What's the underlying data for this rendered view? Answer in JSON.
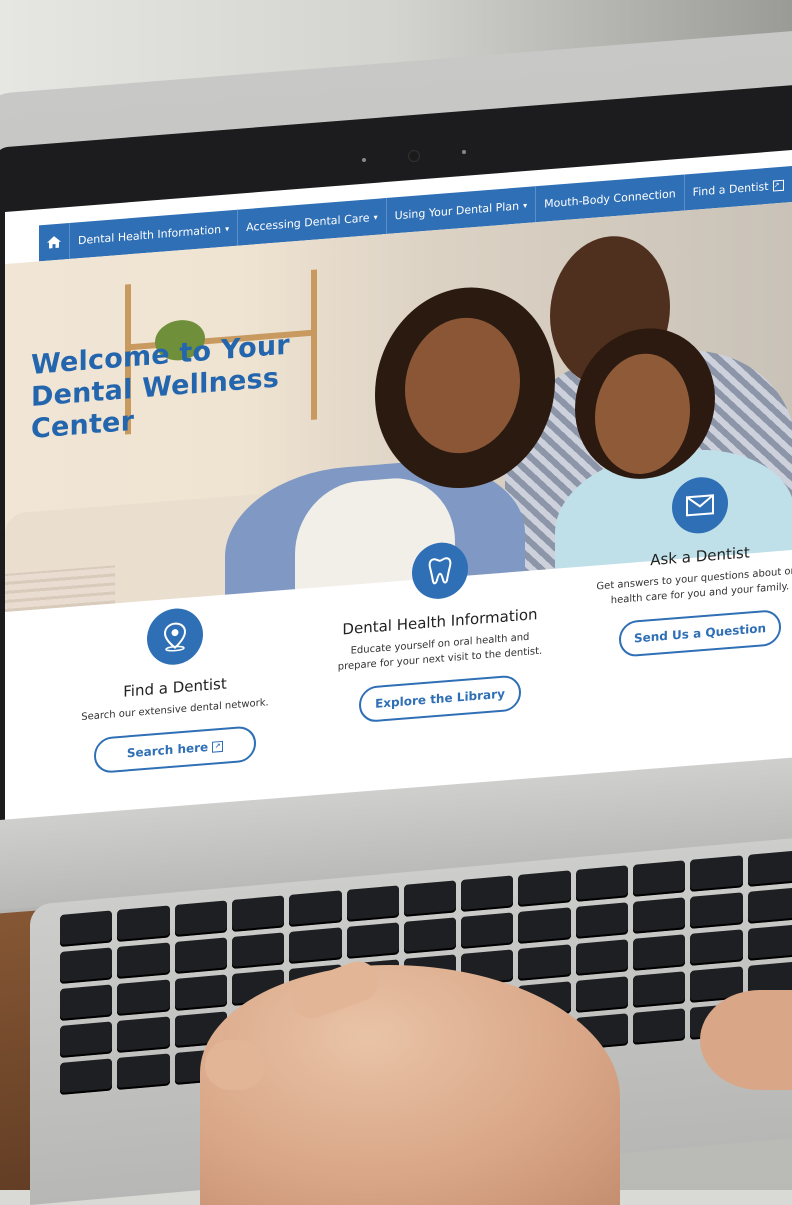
{
  "nav": {
    "items": [
      {
        "label": "Dental Health Information",
        "caret": "▾"
      },
      {
        "label": "Accessing Dental Care",
        "caret": "▾"
      },
      {
        "label": "Using Your Dental Plan",
        "caret": "▾"
      },
      {
        "label": "Mouth-Body Connection",
        "caret": ""
      },
      {
        "label": "Find a Dentist",
        "caret": ""
      }
    ]
  },
  "hero": {
    "title": "Welcome to Your Dental Wellness Center"
  },
  "cards": [
    {
      "title": "Find a Dentist",
      "desc": "Search our extensive dental network.",
      "button": "Search here",
      "icon": "map-pin-icon"
    },
    {
      "title": "Dental Health Information",
      "desc": "Educate yourself on oral health and prepare for your next visit to the dentist.",
      "button": "Explore the Library",
      "icon": "tooth-icon"
    },
    {
      "title": "Ask a Dentist",
      "desc": "Get answers to your questions about oral health care for you and your family.",
      "button": "Send Us a Question",
      "icon": "envelope-icon"
    }
  ],
  "colors": {
    "brand_blue": "#2f6fb5",
    "title_blue": "#2466ae"
  }
}
